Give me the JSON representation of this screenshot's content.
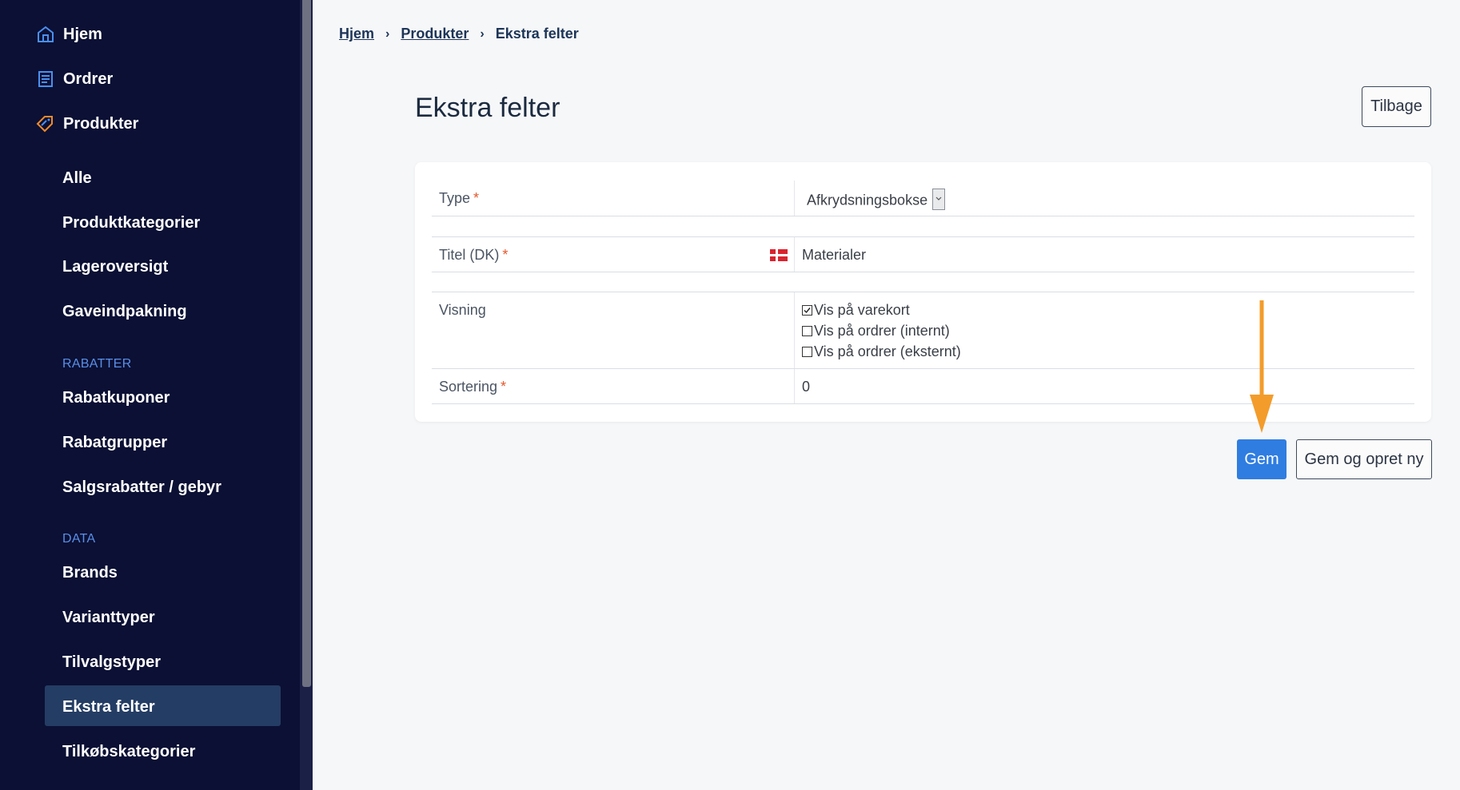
{
  "sidebar": {
    "top_items": [
      {
        "label": "Hjem",
        "icon": "home-icon"
      },
      {
        "label": "Ordrer",
        "icon": "orders-icon"
      },
      {
        "label": "Produkter",
        "icon": "tag-icon"
      }
    ],
    "product_items": [
      "Alle",
      "Produktkategorier",
      "Lageroversigt",
      "Gaveindpakning"
    ],
    "rabatter_heading": "RABATTER",
    "rabatter_items": [
      "Rabatkuponer",
      "Rabatgrupper",
      "Salgsrabatter / gebyr"
    ],
    "data_heading": "DATA",
    "data_items": [
      "Brands",
      "Varianttyper",
      "Tilvalgstyper",
      "Ekstra felter",
      "Tilkøbskategorier"
    ],
    "active_item": "Ekstra felter"
  },
  "breadcrumb": {
    "home": "Hjem",
    "products": "Produkter",
    "current": "Ekstra felter"
  },
  "page": {
    "title": "Ekstra felter",
    "back_label": "Tilbage"
  },
  "form": {
    "type": {
      "label": "Type",
      "required": "*",
      "value": "Afkrydsningsbokse"
    },
    "title": {
      "label": "Titel (DK)",
      "required": "*",
      "value": "Materialer"
    },
    "visning": {
      "label": "Visning",
      "options": [
        {
          "label": "Vis på varekort",
          "checked": true
        },
        {
          "label": "Vis på ordrer (internt)",
          "checked": false
        },
        {
          "label": "Vis på ordrer (eksternt)",
          "checked": false
        }
      ]
    },
    "sortering": {
      "label": "Sortering",
      "required": "*",
      "value": "0"
    }
  },
  "actions": {
    "save": "Gem",
    "save_new": "Gem og opret ny"
  },
  "colors": {
    "sidebar_bg": "#0b1034",
    "accent": "#2f7de1",
    "annotation_arrow": "#f39c2b",
    "required": "#e4572e"
  }
}
